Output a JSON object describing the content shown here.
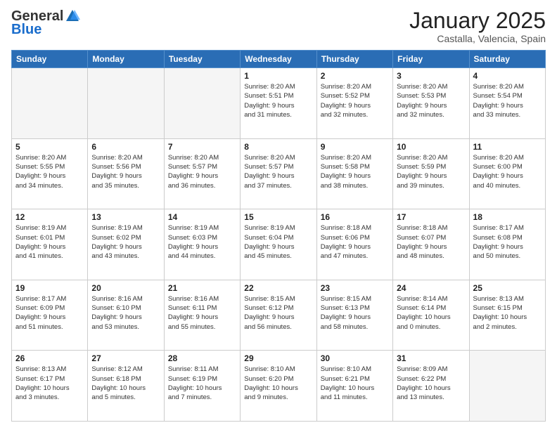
{
  "logo": {
    "general": "General",
    "blue": "Blue"
  },
  "header": {
    "month": "January 2025",
    "location": "Castalla, Valencia, Spain"
  },
  "days_of_week": [
    "Sunday",
    "Monday",
    "Tuesday",
    "Wednesday",
    "Thursday",
    "Friday",
    "Saturday"
  ],
  "weeks": [
    [
      {
        "day": "",
        "info": ""
      },
      {
        "day": "",
        "info": ""
      },
      {
        "day": "",
        "info": ""
      },
      {
        "day": "1",
        "info": "Sunrise: 8:20 AM\nSunset: 5:51 PM\nDaylight: 9 hours\nand 31 minutes."
      },
      {
        "day": "2",
        "info": "Sunrise: 8:20 AM\nSunset: 5:52 PM\nDaylight: 9 hours\nand 32 minutes."
      },
      {
        "day": "3",
        "info": "Sunrise: 8:20 AM\nSunset: 5:53 PM\nDaylight: 9 hours\nand 32 minutes."
      },
      {
        "day": "4",
        "info": "Sunrise: 8:20 AM\nSunset: 5:54 PM\nDaylight: 9 hours\nand 33 minutes."
      }
    ],
    [
      {
        "day": "5",
        "info": "Sunrise: 8:20 AM\nSunset: 5:55 PM\nDaylight: 9 hours\nand 34 minutes."
      },
      {
        "day": "6",
        "info": "Sunrise: 8:20 AM\nSunset: 5:56 PM\nDaylight: 9 hours\nand 35 minutes."
      },
      {
        "day": "7",
        "info": "Sunrise: 8:20 AM\nSunset: 5:57 PM\nDaylight: 9 hours\nand 36 minutes."
      },
      {
        "day": "8",
        "info": "Sunrise: 8:20 AM\nSunset: 5:57 PM\nDaylight: 9 hours\nand 37 minutes."
      },
      {
        "day": "9",
        "info": "Sunrise: 8:20 AM\nSunset: 5:58 PM\nDaylight: 9 hours\nand 38 minutes."
      },
      {
        "day": "10",
        "info": "Sunrise: 8:20 AM\nSunset: 5:59 PM\nDaylight: 9 hours\nand 39 minutes."
      },
      {
        "day": "11",
        "info": "Sunrise: 8:20 AM\nSunset: 6:00 PM\nDaylight: 9 hours\nand 40 minutes."
      }
    ],
    [
      {
        "day": "12",
        "info": "Sunrise: 8:19 AM\nSunset: 6:01 PM\nDaylight: 9 hours\nand 41 minutes."
      },
      {
        "day": "13",
        "info": "Sunrise: 8:19 AM\nSunset: 6:02 PM\nDaylight: 9 hours\nand 43 minutes."
      },
      {
        "day": "14",
        "info": "Sunrise: 8:19 AM\nSunset: 6:03 PM\nDaylight: 9 hours\nand 44 minutes."
      },
      {
        "day": "15",
        "info": "Sunrise: 8:19 AM\nSunset: 6:04 PM\nDaylight: 9 hours\nand 45 minutes."
      },
      {
        "day": "16",
        "info": "Sunrise: 8:18 AM\nSunset: 6:06 PM\nDaylight: 9 hours\nand 47 minutes."
      },
      {
        "day": "17",
        "info": "Sunrise: 8:18 AM\nSunset: 6:07 PM\nDaylight: 9 hours\nand 48 minutes."
      },
      {
        "day": "18",
        "info": "Sunrise: 8:17 AM\nSunset: 6:08 PM\nDaylight: 9 hours\nand 50 minutes."
      }
    ],
    [
      {
        "day": "19",
        "info": "Sunrise: 8:17 AM\nSunset: 6:09 PM\nDaylight: 9 hours\nand 51 minutes."
      },
      {
        "day": "20",
        "info": "Sunrise: 8:16 AM\nSunset: 6:10 PM\nDaylight: 9 hours\nand 53 minutes."
      },
      {
        "day": "21",
        "info": "Sunrise: 8:16 AM\nSunset: 6:11 PM\nDaylight: 9 hours\nand 55 minutes."
      },
      {
        "day": "22",
        "info": "Sunrise: 8:15 AM\nSunset: 6:12 PM\nDaylight: 9 hours\nand 56 minutes."
      },
      {
        "day": "23",
        "info": "Sunrise: 8:15 AM\nSunset: 6:13 PM\nDaylight: 9 hours\nand 58 minutes."
      },
      {
        "day": "24",
        "info": "Sunrise: 8:14 AM\nSunset: 6:14 PM\nDaylight: 10 hours\nand 0 minutes."
      },
      {
        "day": "25",
        "info": "Sunrise: 8:13 AM\nSunset: 6:15 PM\nDaylight: 10 hours\nand 2 minutes."
      }
    ],
    [
      {
        "day": "26",
        "info": "Sunrise: 8:13 AM\nSunset: 6:17 PM\nDaylight: 10 hours\nand 3 minutes."
      },
      {
        "day": "27",
        "info": "Sunrise: 8:12 AM\nSunset: 6:18 PM\nDaylight: 10 hours\nand 5 minutes."
      },
      {
        "day": "28",
        "info": "Sunrise: 8:11 AM\nSunset: 6:19 PM\nDaylight: 10 hours\nand 7 minutes."
      },
      {
        "day": "29",
        "info": "Sunrise: 8:10 AM\nSunset: 6:20 PM\nDaylight: 10 hours\nand 9 minutes."
      },
      {
        "day": "30",
        "info": "Sunrise: 8:10 AM\nSunset: 6:21 PM\nDaylight: 10 hours\nand 11 minutes."
      },
      {
        "day": "31",
        "info": "Sunrise: 8:09 AM\nSunset: 6:22 PM\nDaylight: 10 hours\nand 13 minutes."
      },
      {
        "day": "",
        "info": ""
      }
    ]
  ]
}
